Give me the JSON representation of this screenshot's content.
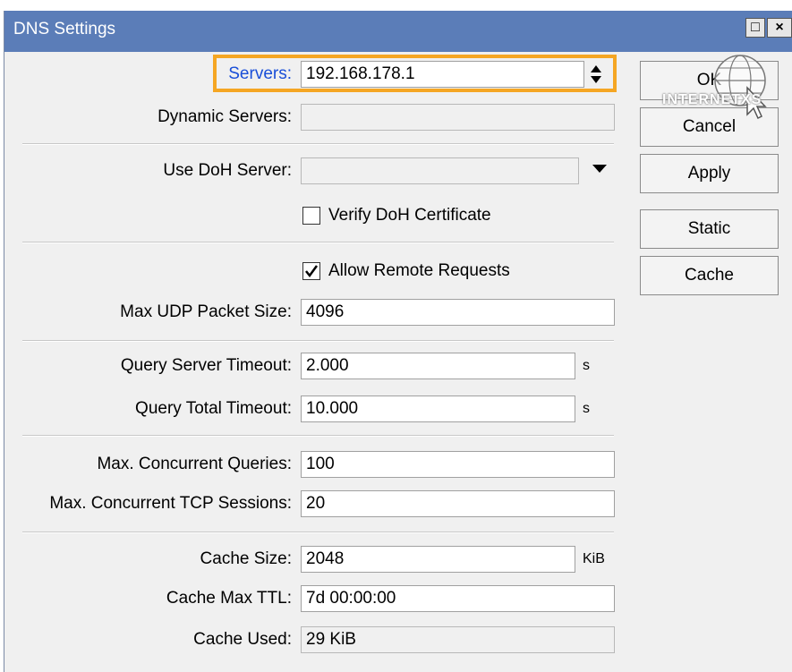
{
  "window": {
    "title": "DNS Settings"
  },
  "titlebar_buttons": {
    "maximize": "□",
    "close": "×"
  },
  "fields": {
    "servers": {
      "label": "Servers:",
      "value": "192.168.178.1"
    },
    "dynamic_servers": {
      "label": "Dynamic Servers:",
      "value": ""
    },
    "use_doh_server": {
      "label": "Use DoH Server:",
      "value": ""
    },
    "verify_doh": {
      "label": "Verify DoH Certificate",
      "checked": false
    },
    "allow_remote": {
      "label": "Allow Remote Requests",
      "checked": true
    },
    "max_udp": {
      "label": "Max UDP Packet Size:",
      "value": "4096"
    },
    "query_server_timeout": {
      "label": "Query Server Timeout:",
      "value": "2.000",
      "unit": "s"
    },
    "query_total_timeout": {
      "label": "Query Total Timeout:",
      "value": "10.000",
      "unit": "s"
    },
    "max_concurrent_queries": {
      "label": "Max. Concurrent Queries:",
      "value": "100"
    },
    "max_concurrent_tcp": {
      "label": "Max. Concurrent TCP Sessions:",
      "value": "20"
    },
    "cache_size": {
      "label": "Cache Size:",
      "value": "2048",
      "unit": "KiB"
    },
    "cache_max_ttl": {
      "label": "Cache Max TTL:",
      "value": "7d 00:00:00"
    },
    "cache_used": {
      "label": "Cache Used:",
      "value": "29 KiB"
    }
  },
  "buttons": {
    "ok": "OK",
    "cancel": "Cancel",
    "apply": "Apply",
    "static": "Static",
    "cache": "Cache"
  },
  "watermark": {
    "text": "INTERNETXS"
  },
  "colors": {
    "titlebar": "#5b7db8",
    "highlight": "#f5a623",
    "servers_label": "#1a4fd8"
  }
}
